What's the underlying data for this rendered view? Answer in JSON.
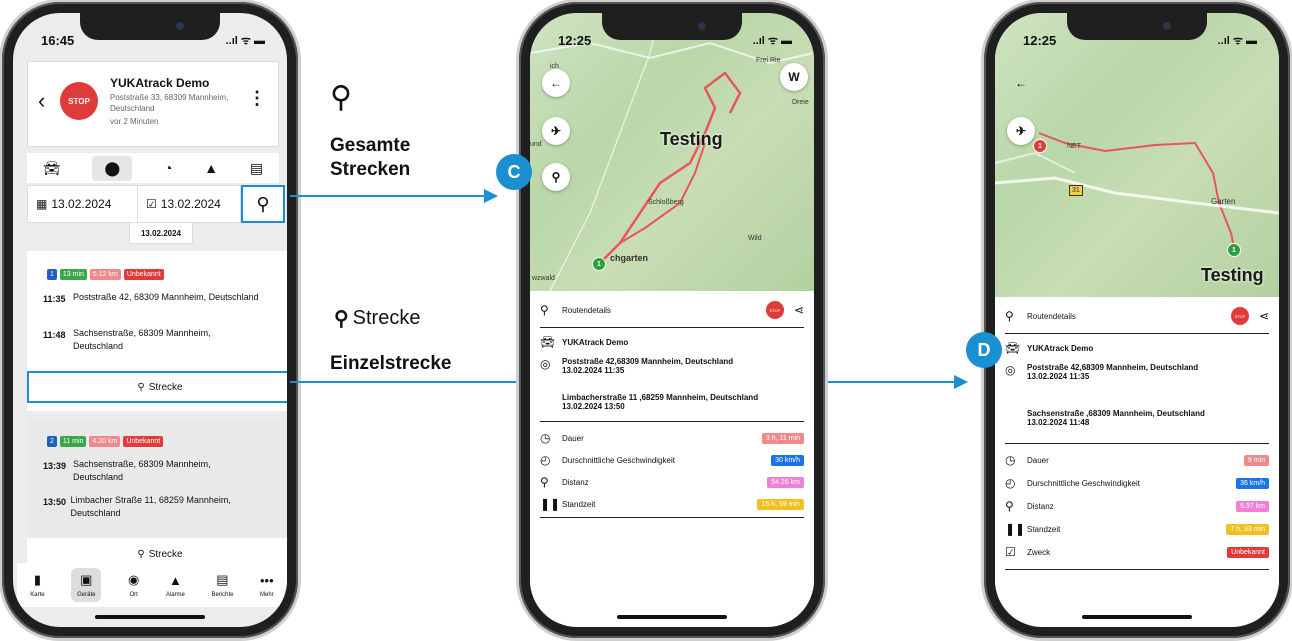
{
  "phone1": {
    "time": "16:45",
    "status": "..ıl ᯤ ▬",
    "device": {
      "stop": "STOP",
      "name": "YUKAtrack Demo",
      "address": "Poststraße 33, 68309 Mannheim, Deutschland",
      "ago": "vor 2 Minuten"
    },
    "dates": {
      "from": "13.02.2024",
      "to": "13.02.2024",
      "chip": "13.02.2024"
    },
    "trip1": {
      "chips": [
        {
          "text": "1",
          "color": "#1f5fbf"
        },
        {
          "text": "13 min",
          "color": "#3aa84a"
        },
        {
          "text": "5.12 km",
          "color": "#f08a8a"
        },
        {
          "text": "Unbekannt",
          "color": "#e03a3a"
        }
      ],
      "stops": [
        {
          "time": "11:35",
          "address": "Poststraße 42, 68309 Mannheim, Deutschland"
        },
        {
          "time": "11:48",
          "address": "Sachsenstraße, 68309 Mannheim, Deutschland"
        }
      ],
      "button": "Strecke"
    },
    "trip2": {
      "chips": [
        {
          "text": "2",
          "color": "#1f5fbf"
        },
        {
          "text": "11 min",
          "color": "#3aa84a"
        },
        {
          "text": "4.20 km",
          "color": "#f08a8a"
        },
        {
          "text": "Unbekannt",
          "color": "#e03a3a"
        }
      ],
      "stops": [
        {
          "time": "13:39",
          "address": "Sachsenstraße, 68309 Mannheim, Deutschland"
        },
        {
          "time": "13:50",
          "address": "Limbacher Straße 11, 68259 Mannheim, Deutschland"
        }
      ],
      "button": "Strecke"
    },
    "nav": [
      "Karte",
      "Geräte",
      "Ort",
      "Alarme",
      "Berichte",
      "Mehr"
    ]
  },
  "annotations": {
    "gesamte": "Gesamte Strecken",
    "strecke_icon_label": "Strecke",
    "einzel": "Einzelstrecke",
    "c": "C",
    "d": "D"
  },
  "phone2": {
    "time": "12:25",
    "status": "..ıl ᯤ ▬",
    "map_label": "Testing",
    "map_small": [
      "Schloßberg",
      "Wild",
      "chgarten",
      "wzwald",
      "Frei Rie",
      "ich",
      "und",
      "Dreie"
    ],
    "compass": "W",
    "pin": "1",
    "details_title": "Routendetails",
    "stop": "STOP",
    "device": "YUKAtrack Demo",
    "start": {
      "address": "Poststraße 42,68309 Mannheim, Deutschland",
      "time": "13.02.2024 11:35"
    },
    "end": {
      "address": "Limbacherstraße 11 ,68259 Mannheim, Deutschland",
      "time": "13.02.2024 13:50"
    },
    "stats": [
      {
        "label": "Dauer",
        "value": "3 h, 11 min",
        "color": "#f08a8a",
        "icon": "clock-icon"
      },
      {
        "label": "Durschnittliche Geschwindigkeit",
        "value": "30 km/h",
        "color": "#1a73e8",
        "icon": "speedometer-icon"
      },
      {
        "label": "Distanz",
        "value": "54.26 km",
        "color": "#f07fd6",
        "icon": "route-icon"
      },
      {
        "label": "Standzeit",
        "value": "15 h, 59 min",
        "color": "#f0c020",
        "icon": "pause-icon"
      }
    ]
  },
  "phone3": {
    "time": "12:25",
    "status": "..ıl ᯤ ▬",
    "map_label": "Testing",
    "map_small": [
      "NET",
      "Garten",
      "31"
    ],
    "pin_start": "1",
    "pin_end": "1",
    "details_title": "Routendetails",
    "stop": "STOP",
    "device": "YUKAtrack Demo",
    "start": {
      "address": "Poststraße 42,68309 Mannheim, Deutschland",
      "time": "13.02.2024 11:35"
    },
    "end": {
      "address": "Sachsenstraße ,68309 Mannheim, Deutschland",
      "time": "13.02.2024 11:48"
    },
    "stats": [
      {
        "label": "Dauer",
        "value": "9 min",
        "color": "#f08a8a",
        "icon": "clock-icon"
      },
      {
        "label": "Durschnittliche Geschwindigkeit",
        "value": "36 km/h",
        "color": "#1a73e8",
        "icon": "speedometer-icon"
      },
      {
        "label": "Distanz",
        "value": "5.97 km",
        "color": "#f07fd6",
        "icon": "route-icon"
      },
      {
        "label": "Standzeit",
        "value": "7 h, 33 min",
        "color": "#f0c020",
        "icon": "pause-icon"
      },
      {
        "label": "Zweck",
        "value": "Unbekannt",
        "color": "#e03a3a",
        "icon": "purpose-icon"
      }
    ]
  }
}
